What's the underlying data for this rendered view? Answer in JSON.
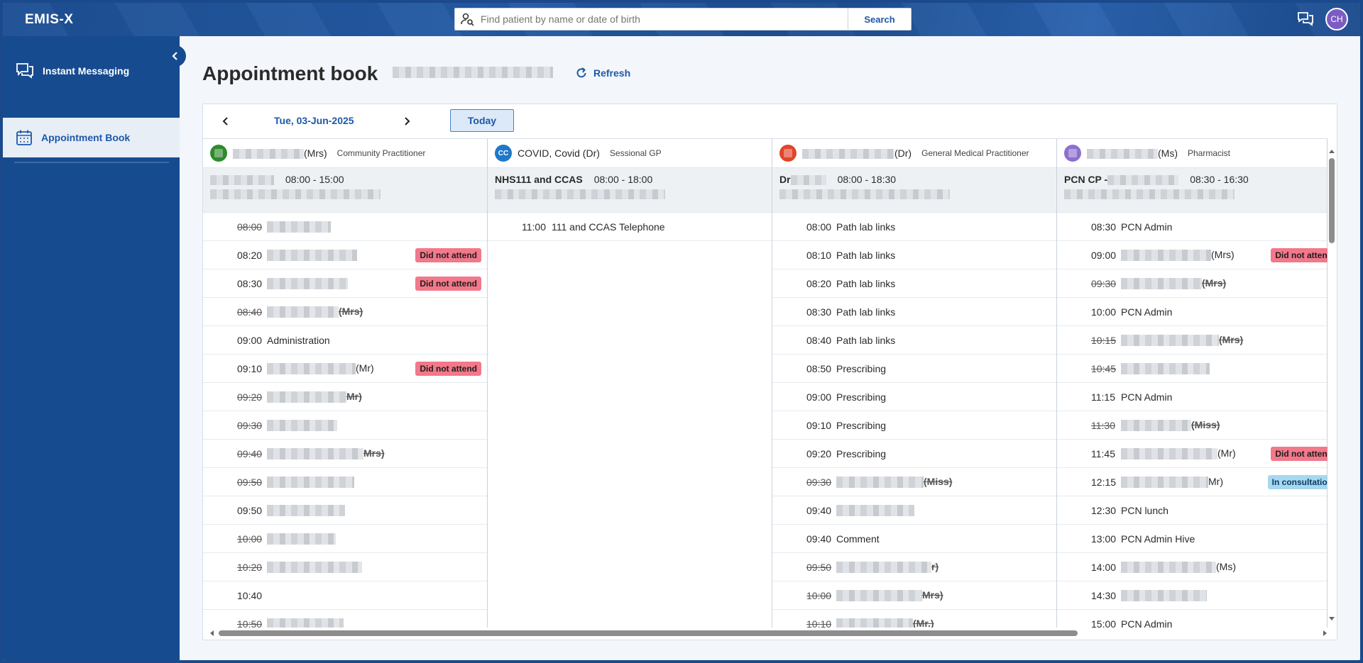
{
  "app": {
    "logo": "EMIS-X"
  },
  "search": {
    "placeholder": "Find patient by name or date of birth",
    "button": "Search"
  },
  "user": {
    "initials": "CH"
  },
  "sidebar": {
    "items": [
      {
        "label": "Instant Messaging",
        "icon": "chat-icon"
      },
      {
        "label": "Appointment Book",
        "icon": "calendar-icon"
      }
    ]
  },
  "page": {
    "title": "Appointment book",
    "refresh": "Refresh"
  },
  "datebar": {
    "date": "Tue, 03-Jun-2025",
    "today": "Today"
  },
  "columns": [
    {
      "name": "(Mrs)",
      "role": "Community Practitioner",
      "avatar_color": "#2e8b2e",
      "session_name": "",
      "session_time": "08:00 - 15:00",
      "slots": [
        {
          "time": "08:00",
          "strike": true,
          "desc": "",
          "suffix": "",
          "badge": ""
        },
        {
          "time": "08:20",
          "strike": false,
          "desc": "",
          "suffix": "",
          "badge": "Did not attend"
        },
        {
          "time": "08:30",
          "strike": false,
          "desc": "",
          "suffix": "",
          "badge": "Did not attend"
        },
        {
          "time": "08:40",
          "strike": true,
          "desc": "",
          "suffix": "(Mrs)",
          "badge": ""
        },
        {
          "time": "09:00",
          "strike": false,
          "desc": "Administration",
          "suffix": "",
          "badge": ""
        },
        {
          "time": "09:10",
          "strike": false,
          "desc": "",
          "suffix": "(Mr)",
          "badge": "Did not attend"
        },
        {
          "time": "09:20",
          "strike": true,
          "desc": "",
          "suffix": "Mr)",
          "badge": ""
        },
        {
          "time": "09:30",
          "strike": true,
          "desc": "",
          "suffix": "",
          "badge": ""
        },
        {
          "time": "09:40",
          "strike": true,
          "desc": "",
          "suffix": "Mrs)",
          "badge": ""
        },
        {
          "time": "09:50",
          "strike": true,
          "desc": "",
          "suffix": "",
          "badge": ""
        },
        {
          "time": "09:50",
          "strike": false,
          "desc": "",
          "suffix": "",
          "badge": ""
        },
        {
          "time": "10:00",
          "strike": true,
          "desc": "",
          "suffix": "",
          "badge": ""
        },
        {
          "time": "10:20",
          "strike": true,
          "desc": "",
          "suffix": "",
          "badge": ""
        },
        {
          "time": "10:40",
          "strike": false,
          "desc": "",
          "suffix": "",
          "badge": ""
        },
        {
          "time": "10:50",
          "strike": true,
          "desc": "",
          "suffix": "",
          "badge": ""
        }
      ]
    },
    {
      "name": "COVID, Covid (Dr)",
      "role": "Sessional GP",
      "avatar_color": "#1f78c8",
      "avatar_text": "CC",
      "session_name": "NHS111 and CCAS",
      "session_time": "08:00 - 18:00",
      "slots": [
        {
          "time": "11:00",
          "strike": false,
          "desc": "111 and CCAS Telephone",
          "suffix": "",
          "badge": ""
        }
      ]
    },
    {
      "name": "(Dr)",
      "role": "General Medical Practitioner",
      "avatar_color": "#e0452a",
      "session_name": "Dr",
      "session_time": "08:00 - 18:30",
      "slots": [
        {
          "time": "08:00",
          "strike": false,
          "desc": "Path lab links",
          "suffix": "",
          "badge": ""
        },
        {
          "time": "08:10",
          "strike": false,
          "desc": "Path lab links",
          "suffix": "",
          "badge": ""
        },
        {
          "time": "08:20",
          "strike": false,
          "desc": "Path lab links",
          "suffix": "",
          "badge": ""
        },
        {
          "time": "08:30",
          "strike": false,
          "desc": "Path lab links",
          "suffix": "",
          "badge": ""
        },
        {
          "time": "08:40",
          "strike": false,
          "desc": "Path lab links",
          "suffix": "",
          "badge": ""
        },
        {
          "time": "08:50",
          "strike": false,
          "desc": "Prescribing",
          "suffix": "",
          "badge": ""
        },
        {
          "time": "09:00",
          "strike": false,
          "desc": "Prescribing",
          "suffix": "",
          "badge": ""
        },
        {
          "time": "09:10",
          "strike": false,
          "desc": "Prescribing",
          "suffix": "",
          "badge": ""
        },
        {
          "time": "09:20",
          "strike": false,
          "desc": "Prescribing",
          "suffix": "",
          "badge": ""
        },
        {
          "time": "09:30",
          "strike": true,
          "desc": "",
          "suffix": "(Miss)",
          "badge": ""
        },
        {
          "time": "09:40",
          "strike": false,
          "desc": "",
          "suffix": "",
          "badge": ""
        },
        {
          "time": "09:40",
          "strike": false,
          "desc": "Comment",
          "suffix": "",
          "badge": ""
        },
        {
          "time": "09:50",
          "strike": true,
          "desc": "",
          "suffix": "r)",
          "badge": ""
        },
        {
          "time": "10:00",
          "strike": true,
          "desc": "",
          "suffix": "Mrs)",
          "badge": ""
        },
        {
          "time": "10:10",
          "strike": true,
          "desc": "",
          "suffix": "(Mr.)",
          "badge": ""
        }
      ]
    },
    {
      "name": "(Ms)",
      "role": "Pharmacist",
      "avatar_color": "#8e6fcf",
      "session_name": "PCN CP -",
      "session_time": "08:30 - 16:30",
      "slots": [
        {
          "time": "08:30",
          "strike": false,
          "desc": "PCN Admin",
          "suffix": "",
          "badge": ""
        },
        {
          "time": "09:00",
          "strike": false,
          "desc": "",
          "suffix": "(Mrs)",
          "badge": "Did not attend"
        },
        {
          "time": "09:30",
          "strike": true,
          "desc": "",
          "suffix": "(Mrs)",
          "badge": ""
        },
        {
          "time": "10:00",
          "strike": false,
          "desc": "PCN Admin",
          "suffix": "",
          "badge": ""
        },
        {
          "time": "10:15",
          "strike": true,
          "desc": "",
          "suffix": "(Mrs)",
          "badge": ""
        },
        {
          "time": "10:45",
          "strike": true,
          "desc": "",
          "suffix": "",
          "badge": ""
        },
        {
          "time": "11:15",
          "strike": false,
          "desc": "PCN Admin",
          "suffix": "",
          "badge": ""
        },
        {
          "time": "11:30",
          "strike": true,
          "desc": "",
          "suffix": "(Miss)",
          "badge": ""
        },
        {
          "time": "11:45",
          "strike": false,
          "desc": "",
          "suffix": "(Mr)",
          "badge": "Did not attend"
        },
        {
          "time": "12:15",
          "strike": false,
          "desc": "",
          "suffix": "Mr)",
          "badge": "In consultation"
        },
        {
          "time": "12:30",
          "strike": false,
          "desc": "PCN lunch",
          "suffix": "",
          "badge": ""
        },
        {
          "time": "13:00",
          "strike": false,
          "desc": "PCN Admin Hive",
          "suffix": "",
          "badge": ""
        },
        {
          "time": "14:00",
          "strike": false,
          "desc": "",
          "suffix": "(Ms)",
          "badge": ""
        },
        {
          "time": "14:30",
          "strike": false,
          "desc": "",
          "suffix": "",
          "badge": ""
        },
        {
          "time": "15:00",
          "strike": false,
          "desc": "PCN Admin",
          "suffix": "",
          "badge": ""
        }
      ]
    }
  ]
}
